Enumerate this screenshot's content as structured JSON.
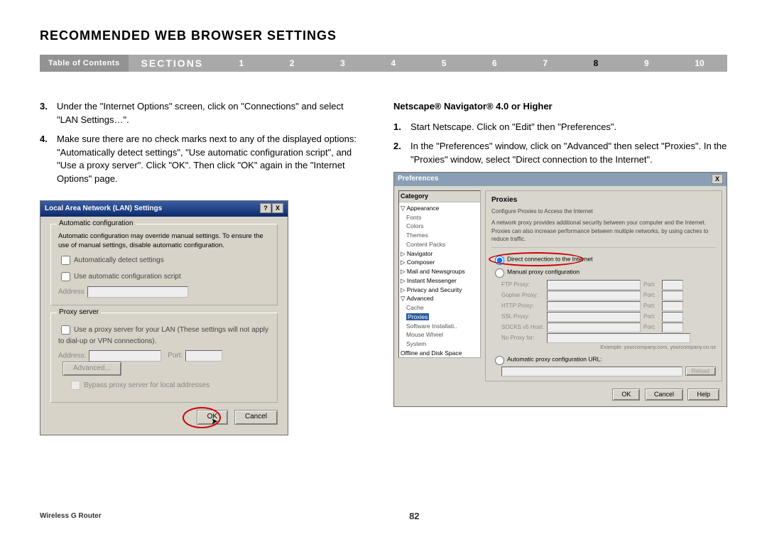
{
  "title": "RECOMMENDED WEB BROWSER SETTINGS",
  "nav": {
    "toc": "Table of Contents",
    "sections": "SECTIONS",
    "items": [
      "1",
      "2",
      "3",
      "4",
      "5",
      "6",
      "7",
      "8",
      "9",
      "10"
    ],
    "active": "8"
  },
  "left_steps": [
    {
      "n": "3.",
      "t": "Under the \"Internet Options\" screen, click on \"Connections\" and select \"LAN Settings…\"."
    },
    {
      "n": "4.",
      "t": "Make sure there are no check marks next to any of the displayed options: \"Automatically detect settings\", \"Use automatic configuration script\", and \"Use a proxy server\". Click \"OK\". Then click \"OK\" again in the \"Internet Options\" page."
    }
  ],
  "right_heading": "Netscape® Navigator® 4.0 or Higher",
  "right_steps": [
    {
      "n": "1.",
      "t": "Start Netscape. Click on \"Edit\" then \"Preferences\"."
    },
    {
      "n": "2.",
      "t": "In the \"Preferences\" window, click on \"Advanced\" then select \"Proxies\". In the \"Proxies\" window, select \"Direct connection to the Internet\"."
    }
  ],
  "lan_dialog": {
    "title": "Local Area Network (LAN) Settings",
    "group1": "Automatic configuration",
    "desc": "Automatic configuration may override manual settings. To ensure the use of manual settings, disable automatic configuration.",
    "cb1": "Automatically detect settings",
    "cb2": "Use automatic configuration script",
    "addr": "Address",
    "group2": "Proxy server",
    "proxy_cb": "Use a proxy server for your LAN (These settings will not apply to dial-up or VPN connections).",
    "addr2": "Address:",
    "port": "Port:",
    "adv": "Advanced...",
    "bypass": "Bypass proxy server for local addresses",
    "ok": "OK",
    "cancel": "Cancel"
  },
  "pref_dialog": {
    "title": "Preferences",
    "category": "Category",
    "tree": {
      "appearance": "Appearance",
      "fonts": "Fonts",
      "colors": "Colors",
      "themes": "Themes",
      "content": "Content Packs",
      "navigator": "Navigator",
      "composer": "Composer",
      "mail": "Mail and Newsgroups",
      "im": "Instant Messenger",
      "privacy": "Privacy and Security",
      "advanced": "Advanced",
      "cache": "Cache",
      "proxies": "Proxies",
      "software": "Software Installati..",
      "mouse": "Mouse Wheel",
      "system": "System",
      "offline": "Offline and Disk Space"
    },
    "right": {
      "hdr": "Proxies",
      "sub": "Configure Proxies to Access the Internet",
      "desc": "A network proxy provides additional security between your computer and the Internet. Proxies can also increase performance between multiple networks, by using caches to reduce traffic.",
      "r1": "Direct connection to the Internet",
      "r2": "Manual proxy configuration",
      "rows": [
        "FTP Proxy:",
        "Gopher Proxy:",
        "HTTP Proxy:",
        "SSL Proxy:",
        "SOCKS v5 Host:",
        "No Proxy for:"
      ],
      "port": "Port:",
      "example": "Example: yourcompany.com, yourcompany.co.nz",
      "r3": "Automatic proxy configuration URL:",
      "reload": "Reload"
    },
    "ok": "OK",
    "cancel": "Cancel",
    "help": "Help"
  },
  "footer": {
    "product": "Wireless G Router",
    "page": "82"
  }
}
